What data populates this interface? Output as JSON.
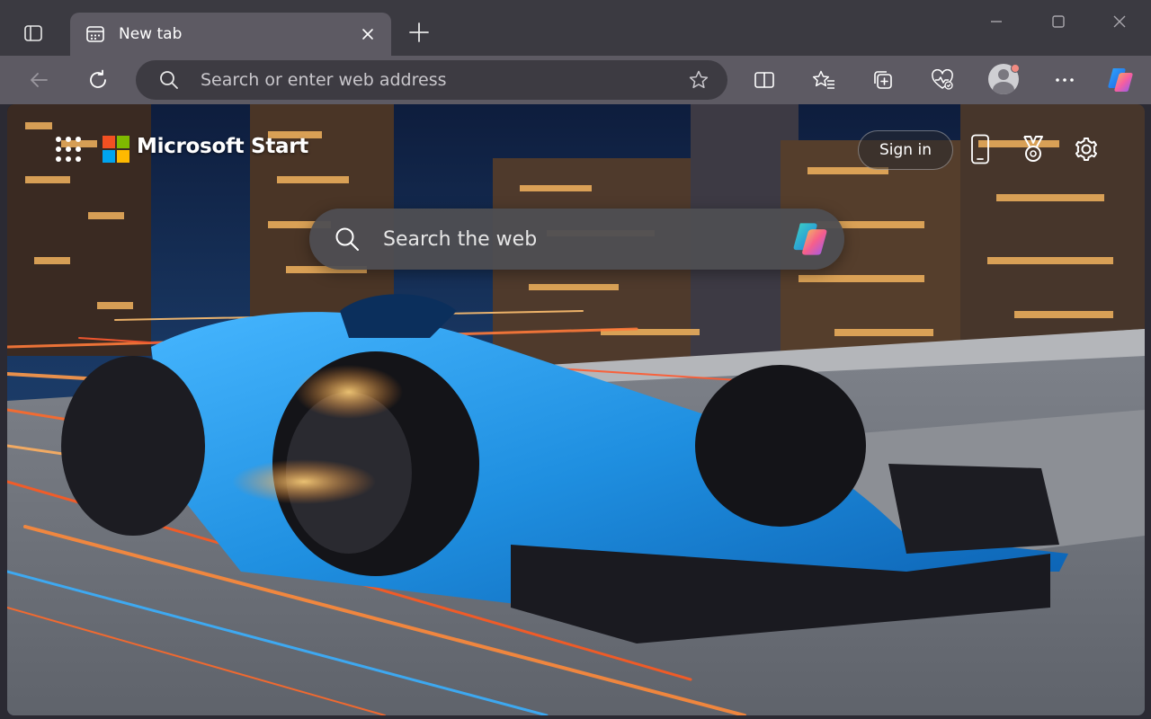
{
  "tab": {
    "title": "New tab"
  },
  "addressbar": {
    "placeholder": "Search or enter web address"
  },
  "start": {
    "brand": "Microsoft Start",
    "signin_label": "Sign in",
    "search_placeholder": "Search the web"
  },
  "icons": {
    "tab_actions": "tab-actions-icon",
    "new_tab_page": "new-tab-page-icon",
    "close_tab": "close-icon",
    "new_tab": "plus-icon",
    "minimize": "minimize-icon",
    "maximize": "maximize-icon",
    "close_window": "close-icon",
    "back": "back-arrow-icon",
    "refresh": "refresh-icon",
    "search": "search-icon",
    "favorite": "star-icon",
    "split_screen": "split-screen-icon",
    "favorites": "favorites-icon",
    "collections": "collections-icon",
    "browser_essentials": "heart-pulse-icon",
    "profile": "profile-avatar",
    "more": "more-dots-icon",
    "copilot": "copilot-icon",
    "apps": "app-launcher-icon",
    "mobile": "phone-icon",
    "rewards": "rewards-medal-icon",
    "settings": "gear-icon"
  },
  "colors": {
    "titlebar": "#3b3a41",
    "toolbar": "#5d5a63",
    "addressbar": "#3d3b42",
    "ms_red": "#f25022",
    "ms_green": "#7fba00",
    "ms_blue": "#00a4ef",
    "ms_yellow": "#ffb900",
    "car_blue": "#1f8fe0"
  }
}
